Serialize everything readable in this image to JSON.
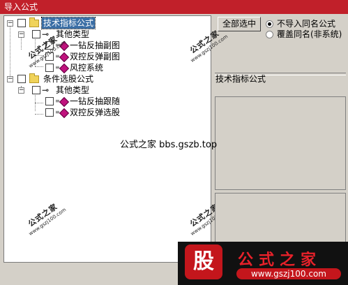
{
  "window": {
    "title": "导入公式"
  },
  "tree": {
    "groups": [
      {
        "label": "技术指标公式",
        "selected": true,
        "subgroup": "其他类型",
        "items": [
          "一钻反抽副图",
          "双控反弹副图",
          "风控系统"
        ]
      },
      {
        "label": "条件选股公式",
        "selected": false,
        "subgroup": "其他类型",
        "items": [
          "一钻反抽跟随",
          "双控反弹选股"
        ]
      }
    ]
  },
  "controls": {
    "select_all_label": "全部选中",
    "radio_options": [
      {
        "label": "不导入同名公式",
        "checked": true
      },
      {
        "label": "覆盖同名(非系统)",
        "checked": false
      }
    ]
  },
  "details": {
    "formula_name": "技术指标公式"
  },
  "watermark": {
    "center_text": "公式之家 bbs.gszb.top",
    "stamp_text": "公式之家",
    "stamp_url": "www.gszj100.com",
    "banner_glyph": "股",
    "banner_title": "公式之家",
    "banner_url": "www.gszj100.com"
  }
}
